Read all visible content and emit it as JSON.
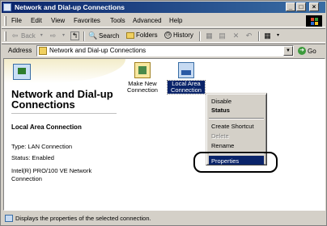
{
  "window": {
    "title": "Network and Dial-up Connections",
    "controls": {
      "minimize": "_",
      "maximize": "□",
      "close": "×"
    }
  },
  "menubar": {
    "items": [
      "File",
      "Edit",
      "View",
      "Favorites",
      "Tools",
      "Advanced",
      "Help"
    ]
  },
  "toolbar": {
    "back": "Back",
    "search": "Search",
    "folders": "Folders",
    "history": "History"
  },
  "address": {
    "label": "Address",
    "value": "Network and Dial-up Connections",
    "go": "Go"
  },
  "panel": {
    "title": "Network and Dial-up Connections",
    "info_heading": "Local Area Connection",
    "type": "Type: LAN Connection",
    "status": "Status: Enabled",
    "adapter": "Intel(R) PRO/100 VE Network Connection"
  },
  "items": [
    {
      "label": "Make New Connection",
      "icon": "make-new-connection-icon"
    },
    {
      "label": "Local Area Connection",
      "icon": "lan-connection-icon",
      "selected": true
    }
  ],
  "context_menu": {
    "items": [
      "Disable",
      "Status",
      "Create Shortcut",
      "Delete",
      "Rename",
      "Properties"
    ],
    "default_item": "Status",
    "disabled_item": "Delete",
    "highlighted_item": "Properties"
  },
  "statusbar": {
    "text": "Displays the properties of the selected connection."
  },
  "colors": {
    "title_bar": "#0a246a",
    "selection": "#0a246a",
    "chrome": "#d4d0c8"
  }
}
